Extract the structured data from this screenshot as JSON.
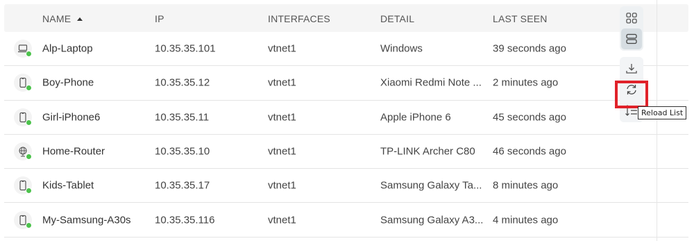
{
  "columns": {
    "name": "NAME",
    "ip": "IP",
    "interfaces": "INTERFACES",
    "detail": "DETAIL",
    "last_seen": "LAST SEEN"
  },
  "rows": [
    {
      "name": "Alp-Laptop",
      "ip": "10.35.35.101",
      "interface": "vtnet1",
      "detail": "Windows",
      "last_seen": "39 seconds ago",
      "icon": "laptop-icon",
      "status": "online"
    },
    {
      "name": "Boy-Phone",
      "ip": "10.35.35.12",
      "interface": "vtnet1",
      "detail": "Xiaomi Redmi Note ...",
      "last_seen": "2 minutes ago",
      "icon": "phone-icon",
      "status": "online"
    },
    {
      "name": "Girl-iPhone6",
      "ip": "10.35.35.11",
      "interface": "vtnet1",
      "detail": "Apple iPhone 6",
      "last_seen": "45 seconds ago",
      "icon": "phone-icon",
      "status": "online"
    },
    {
      "name": "Home-Router",
      "ip": "10.35.35.10",
      "interface": "vtnet1",
      "detail": "TP-LINK Archer C80",
      "last_seen": "46 seconds ago",
      "icon": "router-globe-icon",
      "status": "online"
    },
    {
      "name": "Kids-Tablet",
      "ip": "10.35.35.17",
      "interface": "vtnet1",
      "detail": "Samsung Galaxy Ta...",
      "last_seen": "8 minutes ago",
      "icon": "phone-icon",
      "status": "online"
    },
    {
      "name": "My-Samsung-A30s",
      "ip": "10.35.35.116",
      "interface": "vtnet1",
      "detail": "Samsung Galaxy A3...",
      "last_seen": "4 minutes ago",
      "icon": "phone-icon",
      "status": "online"
    }
  ],
  "toolbar": {
    "view_grid_icon": "grid-view-icon",
    "view_list_icon": "list-view-icon",
    "download_icon": "download-icon",
    "reload_icon": "reload-icon",
    "sort_icon": "sort-lines-icon",
    "tooltip": "Reload List"
  },
  "colors": {
    "online": "#4cc24c",
    "highlight": "#e0222a"
  }
}
